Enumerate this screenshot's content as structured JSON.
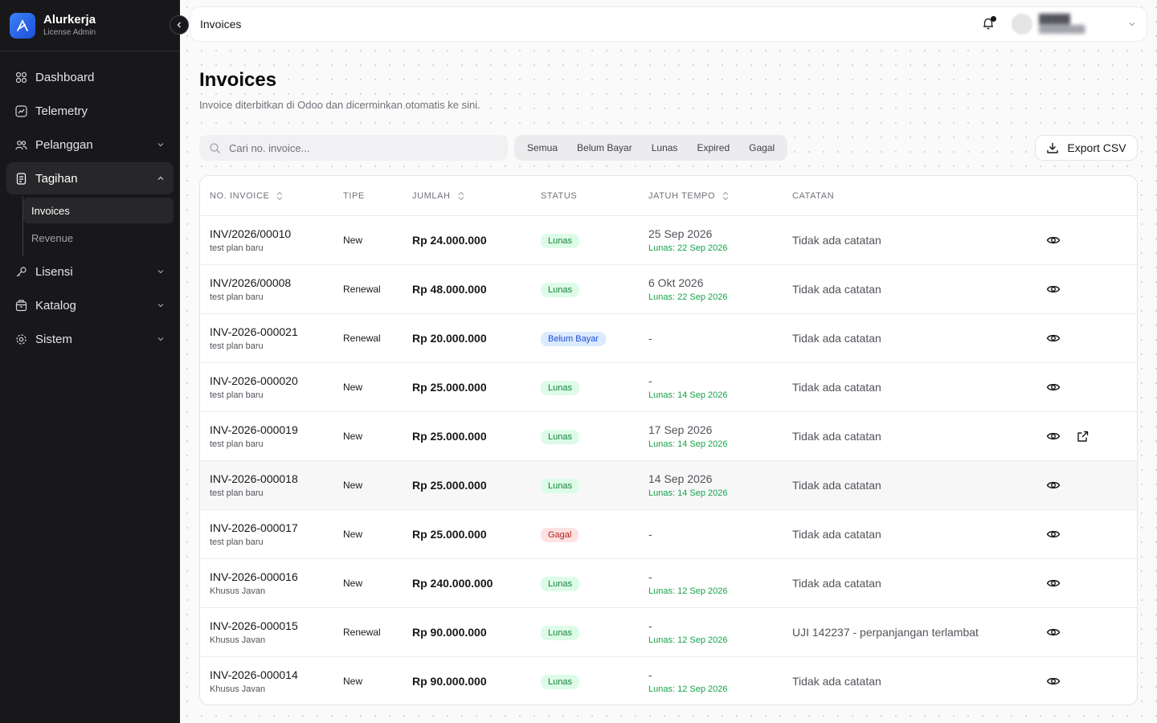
{
  "brand": {
    "name": "Alurkerja",
    "subtitle": "License Admin"
  },
  "nav": {
    "dashboard": "Dashboard",
    "telemetry": "Telemetry",
    "pelanggan": "Pelanggan",
    "tagihan": "Tagihan",
    "tagihan_sub": {
      "invoices": "Invoices",
      "revenue": "Revenue"
    },
    "lisensi": "Lisensi",
    "katalog": "Katalog",
    "sistem": "Sistem"
  },
  "topbar": {
    "title": "Invoices"
  },
  "page": {
    "title": "Invoices",
    "subtitle": "Invoice diterbitkan di Odoo dan dicerminkan otomatis ke sini."
  },
  "search": {
    "placeholder": "Cari no. invoice..."
  },
  "filters": [
    "Semua",
    "Belum Bayar",
    "Lunas",
    "Expired",
    "Gagal"
  ],
  "export_label": "Export CSV",
  "table": {
    "headers": {
      "no_invoice": "NO. INVOICE",
      "tipe": "TIPE",
      "jumlah": "JUMLAH",
      "status": "STATUS",
      "jatuh_tempo": "JATUH TEMPO",
      "catatan": "CATATAN"
    },
    "rows": [
      {
        "no": "INV/2026/00010",
        "plan": "test plan baru",
        "tipe": "New",
        "jumlah": "Rp 24.000.000",
        "status": "Lunas",
        "due": "25 Sep 2026",
        "paid": "Lunas: 22 Sep 2026",
        "note": "Tidak ada catatan"
      },
      {
        "no": "INV/2026/00008",
        "plan": "test plan baru",
        "tipe": "Renewal",
        "jumlah": "Rp 48.000.000",
        "status": "Lunas",
        "due": "6 Okt 2026",
        "paid": "Lunas: 22 Sep 2026",
        "note": "Tidak ada catatan"
      },
      {
        "no": "INV-2026-000021",
        "plan": "test plan baru",
        "tipe": "Renewal",
        "jumlah": "Rp 20.000.000",
        "status": "Belum Bayar",
        "due": "-",
        "paid": "",
        "note": "Tidak ada catatan"
      },
      {
        "no": "INV-2026-000020",
        "plan": "test plan baru",
        "tipe": "New",
        "jumlah": "Rp 25.000.000",
        "status": "Lunas",
        "due": "-",
        "paid": "Lunas: 14 Sep 2026",
        "note": "Tidak ada catatan"
      },
      {
        "no": "INV-2026-000019",
        "plan": "test plan baru",
        "tipe": "New",
        "jumlah": "Rp 25.000.000",
        "status": "Lunas",
        "due": "17 Sep 2026",
        "paid": "Lunas: 14 Sep 2026",
        "note": "Tidak ada catatan"
      },
      {
        "no": "INV-2026-000018",
        "plan": "test plan baru",
        "tipe": "New",
        "jumlah": "Rp 25.000.000",
        "status": "Lunas",
        "due": "14 Sep 2026",
        "paid": "Lunas: 14 Sep 2026",
        "note": "Tidak ada catatan"
      },
      {
        "no": "INV-2026-000017",
        "plan": "test plan baru",
        "tipe": "New",
        "jumlah": "Rp 25.000.000",
        "status": "Gagal",
        "due": "-",
        "paid": "",
        "note": "Tidak ada catatan"
      },
      {
        "no": "INV-2026-000016",
        "plan": "Khusus Javan",
        "tipe": "New",
        "jumlah": "Rp 240.000.000",
        "status": "Lunas",
        "due": "-",
        "paid": "Lunas: 12 Sep 2026",
        "note": "Tidak ada catatan"
      },
      {
        "no": "INV-2026-000015",
        "plan": "Khusus Javan",
        "tipe": "Renewal",
        "jumlah": "Rp 90.000.000",
        "status": "Lunas",
        "due": "-",
        "paid": "Lunas: 12 Sep 2026",
        "note": "UJI 142237 - perpanjangan terlambat"
      },
      {
        "no": "INV-2026-000014",
        "plan": "Khusus Javan",
        "tipe": "New",
        "jumlah": "Rp 90.000.000",
        "status": "Lunas",
        "due": "-",
        "paid": "Lunas: 12 Sep 2026",
        "note": "Tidak ada catatan"
      }
    ]
  },
  "colors": {
    "sidebar_bg": "#18181b",
    "lunas": "#15803d",
    "belum_bayar": "#1d4ed8",
    "gagal": "#b91c1c",
    "accent": "#3b82f6"
  }
}
